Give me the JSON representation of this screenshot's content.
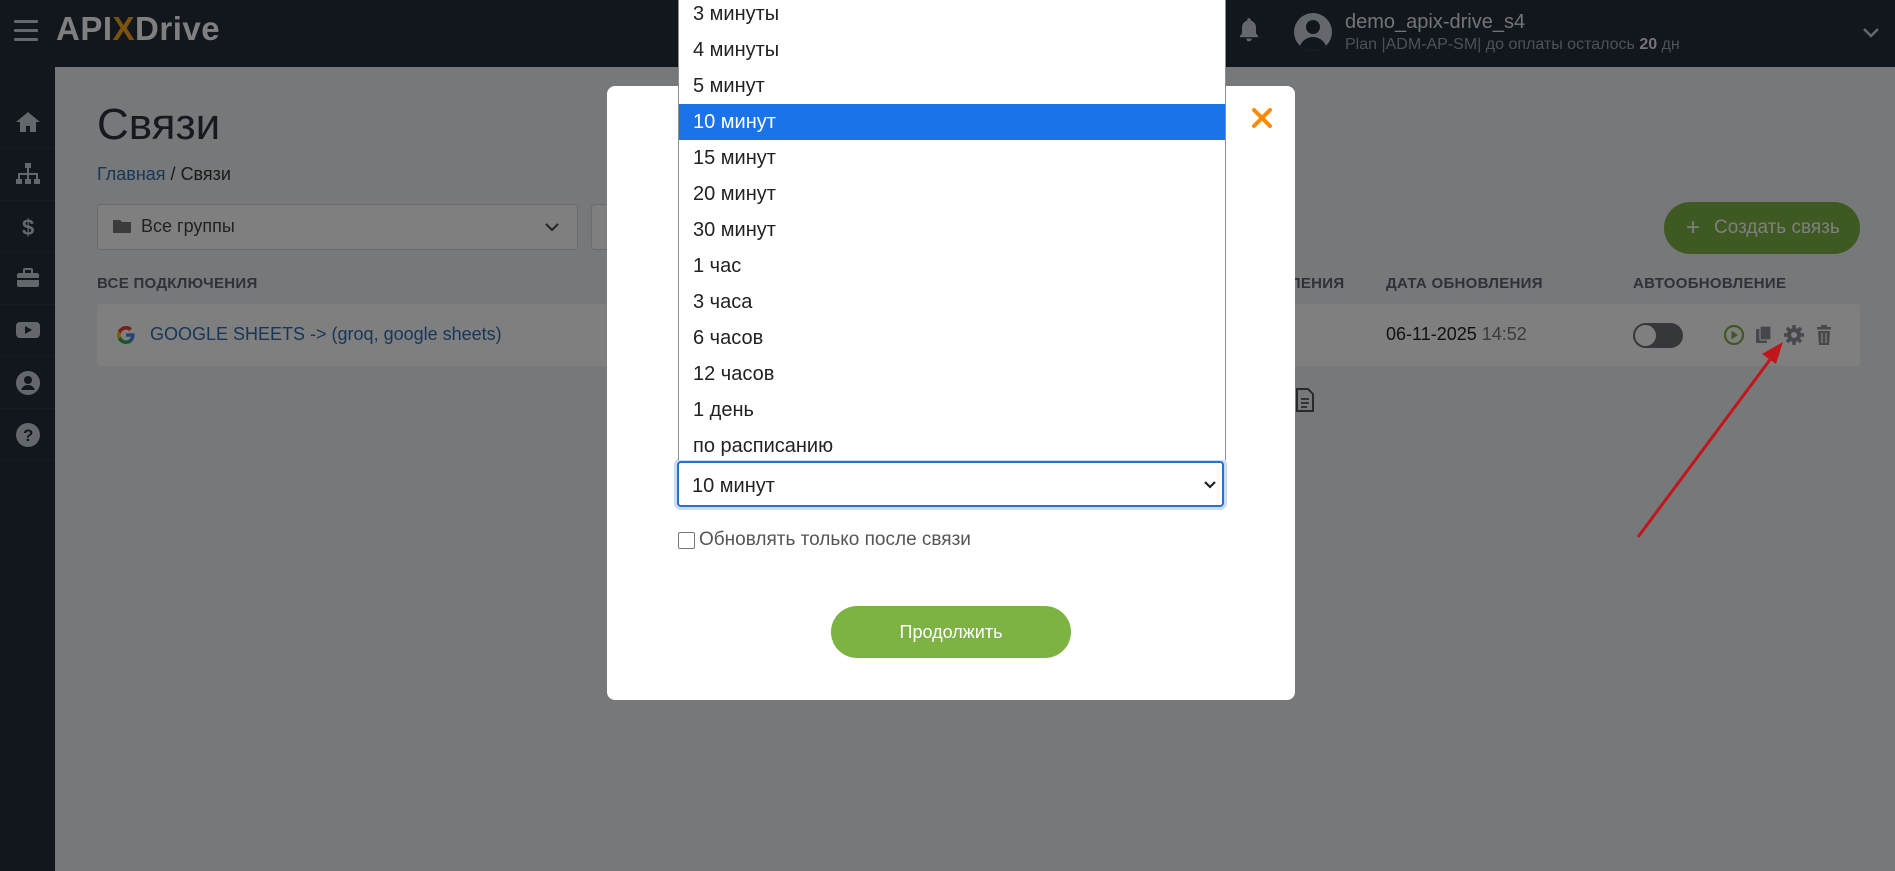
{
  "app": {
    "logo_left": "API",
    "logo_x": "X",
    "logo_right": "Drive",
    "user_name": "demo_apix-drive_s4",
    "plan_prefix": "Plan |ADM-AP-SM| до оплаты осталось ",
    "plan_days": "20",
    "plan_suffix": " дн"
  },
  "sidebar": {
    "items": [
      {
        "icon": "home-icon"
      },
      {
        "icon": "sitemap-icon"
      },
      {
        "icon": "dollar-icon"
      },
      {
        "icon": "briefcase-icon"
      },
      {
        "icon": "youtube-icon"
      },
      {
        "icon": "user-icon"
      },
      {
        "icon": "help-icon"
      }
    ]
  },
  "page": {
    "title": "Связи",
    "breadcrumb_home": "Главная",
    "breadcrumb_sep": "/",
    "breadcrumb_current": "Связи",
    "group_filter": "Все группы",
    "create_button": "Создать связь",
    "create_plus": "+"
  },
  "table": {
    "headers": {
      "all": "ВСЕ ПОДКЛЮЧЕНИЯ",
      "updates_partial": "ЛЕНИЯ",
      "updated": "ДАТА ОБНОВЛЕНИЯ",
      "auto": "АВТООБНОВЛЕНИЕ"
    },
    "rows": [
      {
        "name": "GOOGLE SHEETS -> (groq, google sheets)",
        "date": "06-11-2025",
        "time": "14:52",
        "auto_enabled": false
      }
    ]
  },
  "modal": {
    "selected_value": "10 минут",
    "options": [
      "3 минуты",
      "4 минуты",
      "5 минут",
      "10 минут",
      "15 минут",
      "20 минут",
      "30 минут",
      "1 час",
      "3 часа",
      "6 часов",
      "12 часов",
      "1 день",
      "по расписанию"
    ],
    "selected_index": 3,
    "checkbox_label": "Обновлять только после связи",
    "checkbox_checked": false,
    "continue_button": "Продолжить",
    "close_symbol": "×"
  },
  "colors": {
    "topbar": "#252d3a",
    "accent_green": "#7cb342",
    "link_blue": "#2f6fb5",
    "close_orange": "#ff8a00",
    "highlight_blue": "#1a73e8",
    "annotation_red": "#c0161c"
  }
}
